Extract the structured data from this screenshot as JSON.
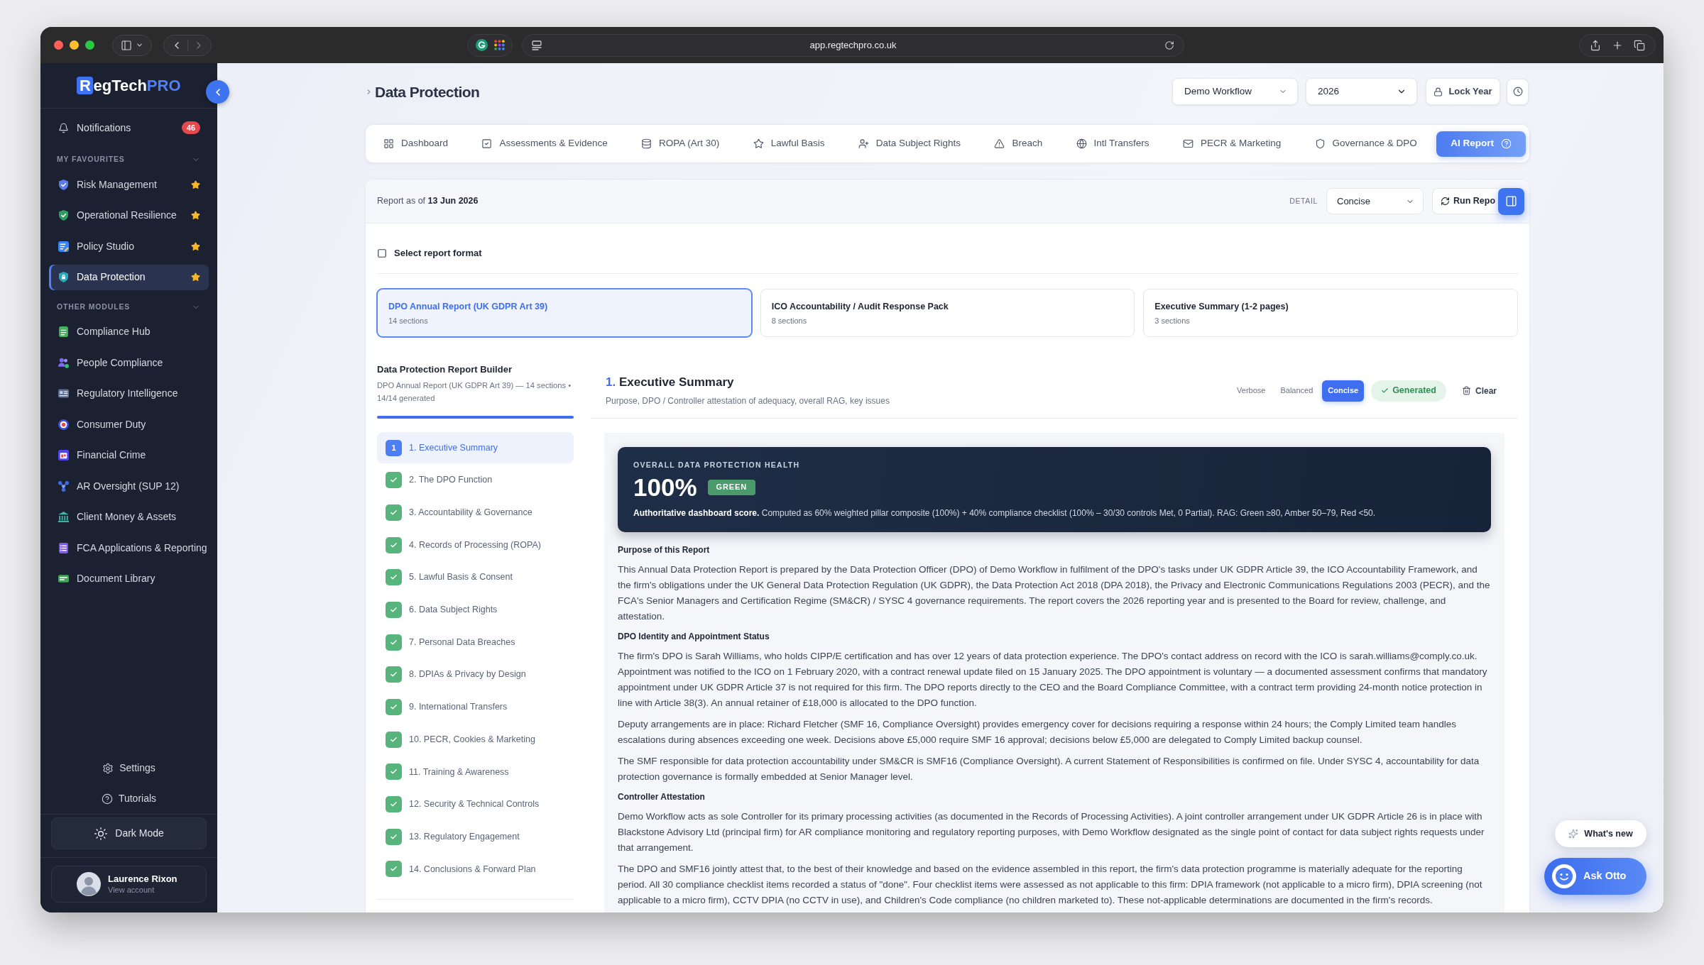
{
  "browser": {
    "url": "app.regtechpro.co.uk"
  },
  "sidebar": {
    "logo": {
      "mark": "R",
      "text": "egTech",
      "accent": "PRO"
    },
    "notifications": {
      "label": "Notifications",
      "badge": "46"
    },
    "sections": [
      {
        "title": "MY FAVOURITES",
        "expanded": true,
        "items": [
          {
            "label": "Risk Management",
            "favourite": true,
            "selected": false
          },
          {
            "label": "Operational Resilience",
            "favourite": true,
            "selected": false
          },
          {
            "label": "Policy Studio",
            "favourite": true,
            "selected": false
          },
          {
            "label": "Data Protection",
            "favourite": true,
            "selected": true
          }
        ]
      },
      {
        "title": "OTHER MODULES",
        "expanded": true,
        "items": [
          {
            "label": "Compliance Hub",
            "favourite": false,
            "selected": false
          },
          {
            "label": "People Compliance",
            "favourite": false,
            "selected": false
          },
          {
            "label": "Regulatory Intelligence",
            "favourite": false,
            "selected": false
          },
          {
            "label": "Consumer Duty",
            "favourite": false,
            "selected": false
          },
          {
            "label": "Financial Crime",
            "favourite": false,
            "selected": false
          },
          {
            "label": "AR Oversight (SUP 12)",
            "favourite": false,
            "selected": false
          },
          {
            "label": "Client Money & Assets",
            "favourite": false,
            "selected": false
          },
          {
            "label": "FCA Applications & Reporting",
            "favourite": false,
            "selected": false
          },
          {
            "label": "Document Library",
            "favourite": false,
            "selected": false
          }
        ]
      }
    ],
    "links": [
      "Settings",
      "Tutorials"
    ],
    "theme_button": "Dark Mode",
    "account": {
      "name": "Laurence Rixon",
      "subtitle": "View account"
    }
  },
  "header": {
    "title": "Data Protection",
    "workflow": "Demo Workflow",
    "year": "2026",
    "lock_button": "Lock Year"
  },
  "tabs": [
    {
      "label": "Dashboard",
      "selected": false
    },
    {
      "label": "Assessments & Evidence",
      "selected": false
    },
    {
      "label": "ROPA (Art 30)",
      "selected": false
    },
    {
      "label": "Lawful Basis",
      "selected": false
    },
    {
      "label": "Data Subject Rights",
      "selected": false
    },
    {
      "label": "Breach",
      "selected": false
    },
    {
      "label": "Intl Transfers",
      "selected": false
    },
    {
      "label": "PECR & Marketing",
      "selected": false
    },
    {
      "label": "Governance & DPO",
      "selected": false
    },
    {
      "label": "AI Report",
      "selected": true
    }
  ],
  "report": {
    "as_of": "Report as of **13 Jun 2026**",
    "detail_label": "DETAIL",
    "detail": "Concise",
    "run_button": "Run Repo",
    "format_toggle": {
      "label": "Select report format",
      "checked": false
    },
    "formats": [
      {
        "title": "DPO Annual Report (UK GDPR Art 39)",
        "subtitle": "14 sections",
        "selected": true
      },
      {
        "title": "ICO Accountability / Audit Response Pack",
        "subtitle": "8 sections",
        "selected": false
      },
      {
        "title": "Executive Summary (1-2 pages)",
        "subtitle": "3 sections",
        "selected": false
      }
    ],
    "builder": {
      "title": "Data Protection Report Builder",
      "subtitle": "DPO Annual Report (UK GDPR Art 39) — 14 sections • 14/14 generated",
      "level": 1,
      "sections": [
        {
          "label": "1. Executive Summary",
          "badge": "1",
          "selected": true
        },
        {
          "label": "2. The DPO Function",
          "generated": true,
          "selected": false
        },
        {
          "label": "3. Accountability & Governance",
          "generated": true,
          "selected": false
        },
        {
          "label": "4. Records of Processing (ROPA)",
          "generated": true,
          "selected": false
        },
        {
          "label": "5. Lawful Basis & Consent",
          "generated": true,
          "selected": false
        },
        {
          "label": "6. Data Subject Rights",
          "generated": true,
          "selected": false
        },
        {
          "label": "7. Personal Data Breaches",
          "generated": true,
          "selected": false
        },
        {
          "label": "8. DPIAs & Privacy by Design",
          "generated": true,
          "selected": false
        },
        {
          "label": "9. International Transfers",
          "generated": true,
          "selected": false
        },
        {
          "label": "10. PECR, Cookies & Marketing",
          "generated": true,
          "selected": false
        },
        {
          "label": "11. Training & Awareness",
          "generated": true,
          "selected": false
        },
        {
          "label": "12. Security & Technical Controls",
          "generated": true,
          "selected": false
        },
        {
          "label": "13. Regulatory Engagement",
          "generated": true,
          "selected": false
        },
        {
          "label": "14. Conclusions & Forward Plan",
          "generated": true,
          "selected": false
        }
      ]
    },
    "section": {
      "number": "1.",
      "title": "Executive Summary",
      "subtitle": "Purpose, DPO / Controller attestation of adequacy, overall RAG, key issues",
      "detail_options": [
        {
          "label": "Verbose",
          "selected": false
        },
        {
          "label": "Balanced",
          "selected": false
        },
        {
          "label": "Concise",
          "selected": true
        }
      ],
      "status": "Generated",
      "clear_button": "Clear",
      "health": {
        "label": "OVERALL DATA PROTECTION HEALTH",
        "score": "100%",
        "rating": "GREEN",
        "note": "**Authoritative dashboard score.** Computed as 60% weighted pillar composite (100%) + 40% compliance checklist (100% – 30/30 controls Met, 0 Partial). RAG: Green ≥80, Amber 50–79, Red <50."
      },
      "body": [
        {
          "kind": "heading",
          "text": "Purpose of this Report"
        },
        {
          "kind": "paragraph",
          "text": "This Annual Data Protection Report is prepared by the Data Protection Officer (DPO) of Demo Workflow in fulfilment of the DPO's tasks under UK GDPR Article 39, the ICO Accountability Framework, and the firm's obligations under the UK General Data Protection Regulation (UK GDPR), the Data Protection Act 2018 (DPA 2018), the Privacy and Electronic Communications Regulations 2003 (PECR), and the FCA's Senior Managers and Certification Regime (SM&CR) / SYSC 4 governance requirements. The report covers the 2026 reporting year and is presented to the Board for review, challenge, and attestation."
        },
        {
          "kind": "heading",
          "text": "DPO Identity and Appointment Status"
        },
        {
          "kind": "paragraph",
          "text": "The firm's DPO is Sarah Williams, who holds CIPP/E certification and has over 12 years of data protection experience. The DPO's contact address on record with the ICO is sarah.williams@comply.co.uk. Appointment was notified to the ICO on 1 February 2020, with a contract renewal update filed on 15 January 2025. The DPO appointment is voluntary — a documented assessment confirms that mandatory appointment under UK GDPR Article 37 is not required for this firm. The DPO reports directly to the CEO and the Board Compliance Committee, with a contract term providing 24-month notice protection in line with Article 38(3). An annual retainer of £18,000 is allocated to the DPO function."
        },
        {
          "kind": "paragraph",
          "text": "Deputy arrangements are in place: Richard Fletcher (SMF 16, Compliance Oversight) provides emergency cover for decisions requiring a response within 24 hours; the Comply Limited team handles escalations during absences exceeding one week. Decisions above £5,000 require SMF 16 approval; decisions below £5,000 are delegated to Comply Limited backup counsel."
        },
        {
          "kind": "paragraph",
          "text": "The SMF responsible for data protection accountability under SM&CR is SMF16 (Compliance Oversight). A current Statement of Responsibilities is confirmed on file. Under SYSC 4, accountability for data protection governance is formally embedded at Senior Manager level."
        },
        {
          "kind": "heading",
          "text": "Controller Attestation"
        },
        {
          "kind": "paragraph",
          "text": "Demo Workflow acts as sole Controller for its primary processing activities (as documented in the Records of Processing Activities). A joint controller arrangement under UK GDPR Article 26 is in place with Blackstone Advisory Ltd (principal firm) for AR compliance monitoring and regulatory reporting purposes, with Demo Workflow designated as the single point of contact for data subject rights requests under that arrangement."
        },
        {
          "kind": "paragraph",
          "text": "The DPO and SMF16 jointly attest that, to the best of their knowledge and based on the evidence assembled in this report, the firm's data protection programme is materially adequate for the reporting period. All 30 compliance checklist items recorded a status of \"done\". Four checklist items were assessed as not applicable to this firm: DPIA framework (not applicable to a micro firm), DPIA screening (not applicable to a micro firm), CCTV DPIA (no CCTV in use), and Children's Code compliance (no children marketed to). These not-applicable determinations are documented in the firm's records."
        }
      ]
    }
  },
  "assistant": {
    "whats_new": "What's new",
    "ask_button": "Ask Otto"
  }
}
